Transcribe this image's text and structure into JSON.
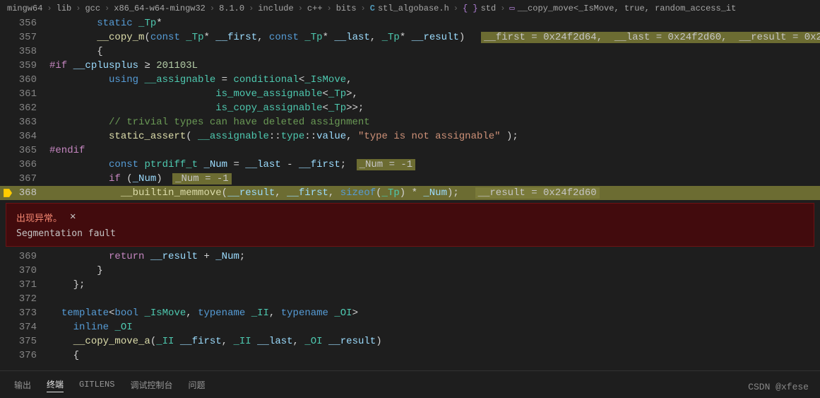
{
  "breadcrumb": {
    "parts": [
      "mingw64",
      "lib",
      "gcc",
      "x86_64-w64-mingw32",
      "8.1.0",
      "include",
      "c++",
      "bits"
    ],
    "file": "stl_algobase.h",
    "ns": "std",
    "symbol": "__copy_move<_IsMove, true, random_access_it"
  },
  "lines": {
    "l356": {
      "num": "356"
    },
    "l357": {
      "num": "357",
      "hint": "__first = 0x24f2d64,  __last = 0x24f2d60,  __result = 0x2"
    },
    "l358": {
      "num": "358"
    },
    "l359": {
      "num": "359"
    },
    "l360": {
      "num": "360"
    },
    "l361": {
      "num": "361"
    },
    "l362": {
      "num": "362"
    },
    "l363": {
      "num": "363",
      "comment": "// trivial types can have deleted assignment"
    },
    "l364": {
      "num": "364",
      "str": "\"type is not assignable\""
    },
    "l365": {
      "num": "365"
    },
    "l366": {
      "num": "366",
      "hint": "_Num = -1"
    },
    "l367": {
      "num": "367",
      "hint": "_Num = -1"
    },
    "l368": {
      "num": "368",
      "hint": "__result = 0x24f2d60"
    },
    "l369": {
      "num": "369"
    },
    "l370": {
      "num": "370"
    },
    "l371": {
      "num": "371"
    },
    "l372": {
      "num": "372"
    },
    "l373": {
      "num": "373"
    },
    "l374": {
      "num": "374"
    },
    "l375": {
      "num": "375"
    },
    "l376": {
      "num": "376"
    }
  },
  "tokens": {
    "static": "static",
    "const": "const",
    "if": "if",
    "return": "return",
    "using": "using",
    "template": "template",
    "typename": "typename",
    "bool": "bool",
    "inline": "inline",
    "ifdef": "#if",
    "endif": "#endif",
    "cplusplus": "__cplusplus",
    "ge": "≥",
    "ver": "201103L",
    "copy_m": "__copy_m",
    "copy_move_a": "__copy_move_a",
    "Tp": "_Tp",
    "first": "__first",
    "last": "__last",
    "result": "__result",
    "Num": "_Num",
    "IsMove": "_IsMove",
    "II": "_II",
    "OI": "_OI",
    "assignable": "__assignable",
    "conditional": "conditional",
    "is_move": "is_move_assignable",
    "is_copy": "is_copy_assignable",
    "static_assert": "static_assert",
    "type": "type",
    "value": "value",
    "ptrdiff_t": "ptrdiff_t",
    "builtin_memmove": "__builtin_memmove",
    "sizeof": "sizeof"
  },
  "exception": {
    "title": "出现异常。",
    "message": "Segmentation fault"
  },
  "panel": {
    "tabs": [
      "输出",
      "终端",
      "GITLENS",
      "调试控制台",
      "问题"
    ]
  },
  "watermark": "CSDN @xfese"
}
